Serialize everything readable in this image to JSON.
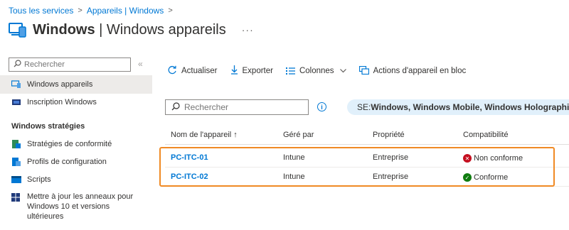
{
  "breadcrumb": {
    "items": [
      "Tous les services",
      "Appareils | Windows"
    ],
    "separator": ">"
  },
  "header": {
    "title_bold": "Windows",
    "title_rest": " | Windows appareils",
    "more": "···"
  },
  "sidebar": {
    "search_placeholder": "Rechercher",
    "collapse": "«",
    "items": [
      {
        "label": "Windows appareils",
        "icon": "devices-icon"
      },
      {
        "label": "Inscription Windows",
        "icon": "enrollment-icon"
      }
    ],
    "section_heading": "Windows stratégies",
    "policy_items": [
      {
        "label": "Stratégies de conformité",
        "icon": "compliance-icon"
      },
      {
        "label": "Profils de configuration",
        "icon": "config-icon"
      },
      {
        "label": "Scripts",
        "icon": "scripts-icon"
      },
      {
        "label": "Mettre à jour les anneaux pour Windows 10 et versions ultérieures",
        "icon": "windows-update-icon"
      }
    ]
  },
  "toolbar": {
    "refresh": "Actualiser",
    "export": "Exporter",
    "columns": "Colonnes",
    "bulk_actions": "Actions d'appareil en bloc"
  },
  "main": {
    "search_placeholder": "Rechercher",
    "filter_label": "SE: ",
    "filter_value": "Windows, Windows Mobile, Windows Holographique"
  },
  "table": {
    "columns": [
      "Nom de l'appareil ↑",
      "Géré par",
      "Propriété",
      "Compatibilité"
    ],
    "rows": [
      {
        "name": "PC-ITC-01",
        "managed_by": "Intune",
        "ownership": "Entreprise",
        "compliance": "Non conforme",
        "status": "error"
      },
      {
        "name": "PC-ITC-02",
        "managed_by": "Intune",
        "ownership": "Entreprise",
        "compliance": "Conforme",
        "status": "ok"
      }
    ]
  },
  "colors": {
    "accent": "#0078d4",
    "highlight": "#f08a24",
    "error": "#c50f1f",
    "success": "#107c10",
    "filter_bg": "#e1f0fb"
  }
}
